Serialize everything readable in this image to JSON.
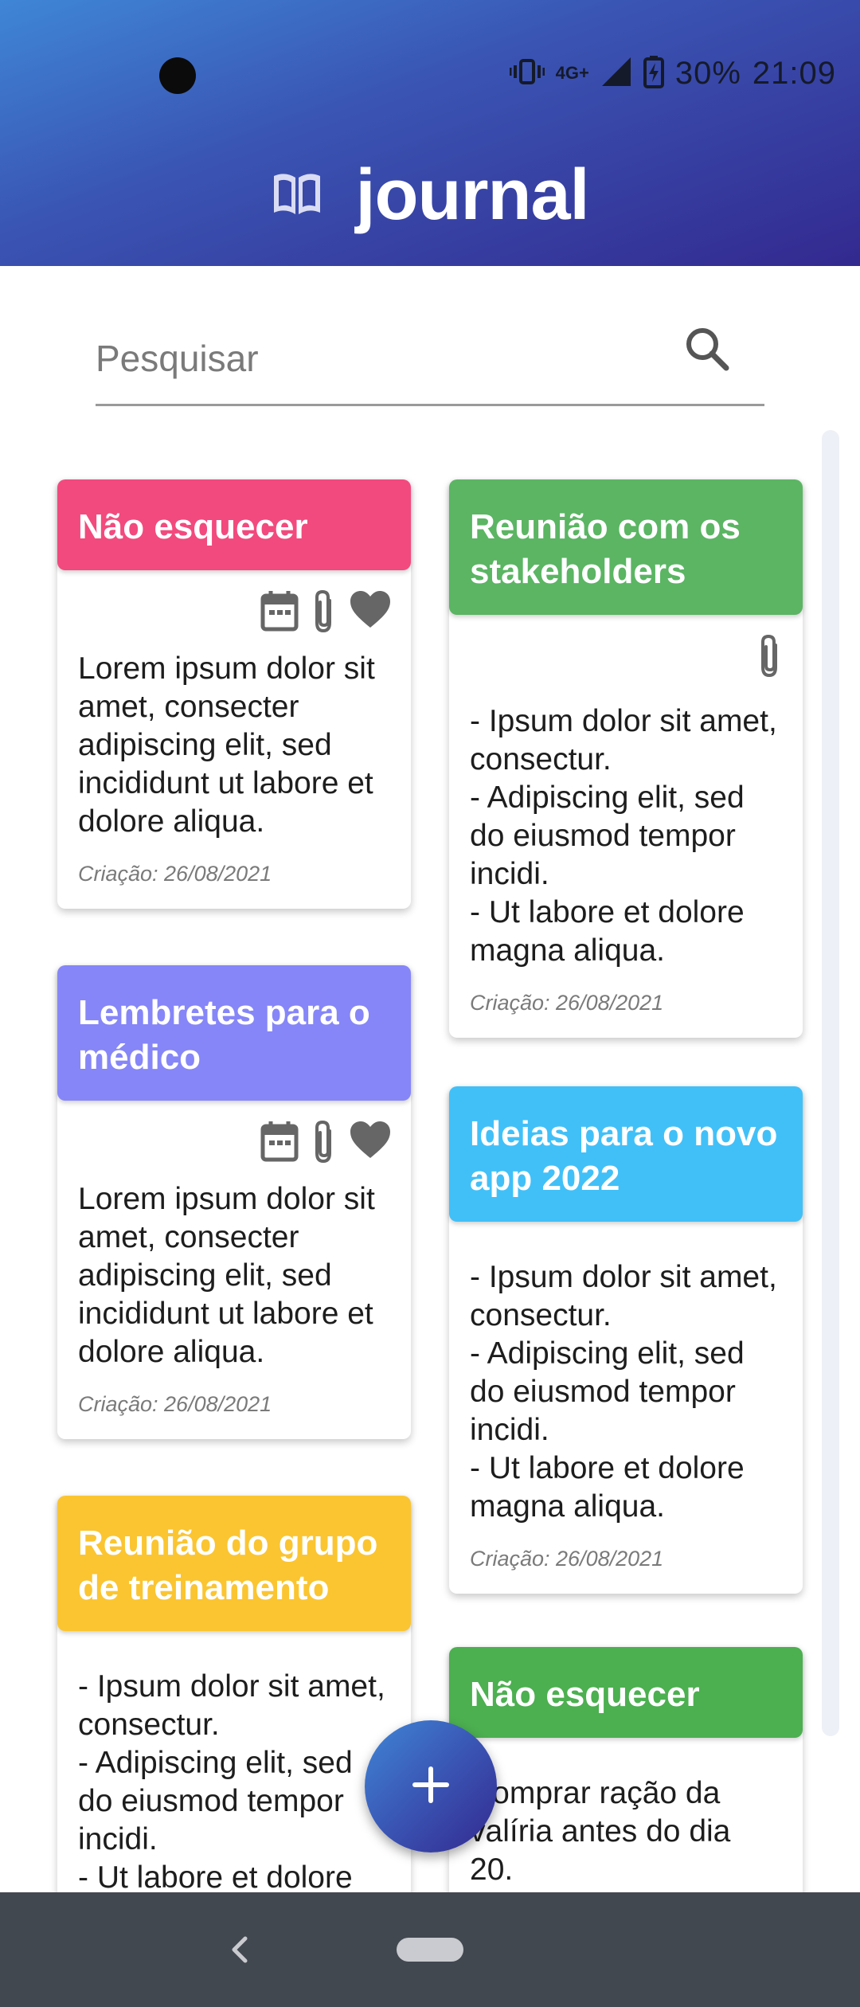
{
  "status_bar": {
    "network": "4G+",
    "battery": "30%",
    "time": "21:09"
  },
  "app": {
    "title": "journal",
    "logo_icon": "open-book-icon"
  },
  "search": {
    "placeholder": "Pesquisar",
    "icon": "search-icon"
  },
  "notes": [
    {
      "title": "Não esquecer",
      "color": "#f24a7e",
      "icons": [
        "calendar-icon",
        "paperclip-icon",
        "heart-icon"
      ],
      "body": "Lorem ipsum dolor sit amet, consecter adipiscing elit, sed incididunt ut labore et dolore aliqua.",
      "date": "Criação: 26/08/2021"
    },
    {
      "title": "Reunião com os stakeholders",
      "color": "#5bb563",
      "icons": [
        "paperclip-icon"
      ],
      "body": "- Ipsum dolor sit amet, consectur.\n- Adipiscing elit, sed do eiusmod tempor incidi.\n- Ut labore et dolore magna aliqua.",
      "date": "Criação: 26/08/2021"
    },
    {
      "title": "Lembretes para o médico",
      "color": "#8686f8",
      "icons": [
        "calendar-icon",
        "paperclip-icon",
        "heart-icon"
      ],
      "body": "Lorem ipsum dolor sit amet, consecter adipiscing elit, sed incididunt ut labore et dolore aliqua.",
      "date": "Criação: 26/08/2021"
    },
    {
      "title": "Ideias para o novo app 2022",
      "color": "#41c0f8",
      "icons": [],
      "body": "- Ipsum dolor sit amet, consectur.\n- Adipiscing elit, sed do eiusmod tempor incidi.\n- Ut labore et dolore magna aliqua.",
      "date": "Criação: 26/08/2021"
    },
    {
      "title": "Reunião do grupo de treinamento",
      "color": "#fbc531",
      "icons": [],
      "body": "- Ipsum dolor sit amet, consectur.\n- Adipiscing elit, sed do eiusmod tempor incidi.\n- Ut labore et dolore magna aliqua.",
      "date": ""
    },
    {
      "title": "Não esquecer",
      "color": "#4caf50",
      "icons": [],
      "body": "Comprar ração da valíria antes do dia 20.",
      "date": ""
    }
  ],
  "fab": {
    "icon": "plus-icon"
  },
  "nav_bar": {
    "back_icon": "back-chevron-icon",
    "home_icon": "home-pill-icon"
  }
}
